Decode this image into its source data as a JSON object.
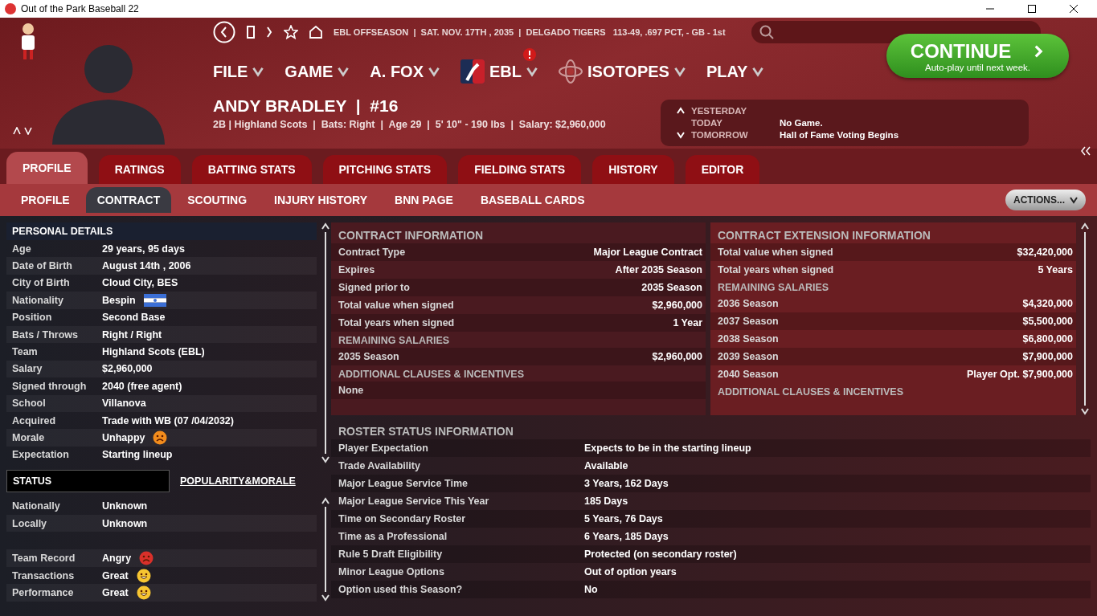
{
  "window": {
    "title": "Out of the Park Baseball 22"
  },
  "header": {
    "status": "EBL OFFSEASON  |  SAT. NOV. 17TH , 2035  |  DELGADO TIGERS   113-49, .697 PCT, - GB - 1st",
    "menus": [
      {
        "label": "FILE",
        "kind": "plain",
        "alert": false
      },
      {
        "label": "GAME",
        "kind": "plain",
        "alert": false
      },
      {
        "label": "A. FOX",
        "kind": "plain",
        "alert": false
      },
      {
        "label": "EBL",
        "kind": "league",
        "alert": true
      },
      {
        "label": "ISOTOPES",
        "kind": "team",
        "alert": false
      },
      {
        "label": "PLAY",
        "kind": "plain",
        "alert": false
      }
    ],
    "continue": {
      "label": "CONTINUE",
      "sub": "Auto-play until next week."
    },
    "player": {
      "name": "ANDY BRADLEY  |  #16",
      "info": "2B | Highland Scots  |  Bats: Right  |  Age 29  |  5' 10\" - 190 lbs  |  Salary: $2,960,000"
    },
    "calendar": [
      {
        "day": "YESTERDAY"
      },
      {
        "day": "TODAY",
        "event": "No Game."
      },
      {
        "day": "TOMORROW",
        "event": "Hall of Fame Voting Begins"
      }
    ]
  },
  "tabs": [
    {
      "label": "PROFILE",
      "selected": true
    },
    {
      "label": "RATINGS",
      "selected": false
    },
    {
      "label": "BATTING STATS",
      "selected": false
    },
    {
      "label": "PITCHING STATS",
      "selected": false
    },
    {
      "label": "FIELDING STATS",
      "selected": false
    },
    {
      "label": "HISTORY",
      "selected": false
    },
    {
      "label": "EDITOR",
      "selected": false
    }
  ],
  "subtabs": [
    {
      "label": "PROFILE",
      "selected": false
    },
    {
      "label": "CONTRACT",
      "selected": true
    },
    {
      "label": "SCOUTING",
      "selected": false
    },
    {
      "label": "INJURY HISTORY",
      "selected": false
    },
    {
      "label": "BNN PAGE",
      "selected": false
    },
    {
      "label": "BASEBALL CARDS",
      "selected": false
    }
  ],
  "actions": "ACTIONS...",
  "personal": {
    "title": "PERSONAL DETAILS",
    "rows": [
      {
        "label": "Age",
        "value": "29 years, 95 days",
        "kind": "plain"
      },
      {
        "label": "Date of Birth",
        "value": "August 14th , 2006",
        "kind": "plain"
      },
      {
        "label": "City of Birth",
        "value": "Cloud City, BES",
        "kind": "plain"
      },
      {
        "label": "Nationality",
        "value": "Bespin",
        "kind": "flag"
      },
      {
        "label": "Position",
        "value": "Second Base",
        "kind": "plain"
      },
      {
        "label": "Bats / Throws",
        "value": "Right / Right",
        "kind": "plain"
      },
      {
        "label": "Team",
        "value": "Highland Scots (EBL)",
        "kind": "plain"
      },
      {
        "label": "Salary",
        "value": "$2,960,000",
        "kind": "plain"
      },
      {
        "label": "Signed through",
        "value": "2040 (free agent)",
        "kind": "plain"
      },
      {
        "label": "School",
        "value": "Villanova",
        "kind": "plain"
      },
      {
        "label": "Acquired",
        "value": "Trade with WB (07 /04/2032)",
        "kind": "plain"
      },
      {
        "label": "Morale",
        "value": "Unhappy",
        "kind": "sad"
      },
      {
        "label": "Expectation",
        "value": "Starting lineup",
        "kind": "plain"
      }
    ]
  },
  "status": {
    "tabs": [
      {
        "label": "STATUS",
        "selected": true
      },
      {
        "label": "POPULARITY&MORALE",
        "selected": false
      }
    ],
    "rows": [
      {
        "label": "Nationally",
        "value": "Unknown",
        "kind": "plain"
      },
      {
        "label": "Locally",
        "value": "Unknown",
        "kind": "plain"
      },
      {
        "kind": "blank"
      },
      {
        "label": "Team Record",
        "value": "Angry",
        "kind": "angry"
      },
      {
        "label": "Transactions",
        "value": "Great",
        "kind": "happy"
      },
      {
        "label": "Performance",
        "value": "Great",
        "kind": "happy"
      }
    ]
  },
  "contract": {
    "title": "CONTRACT INFORMATION",
    "rows": [
      {
        "kind": "row",
        "label": "Contract Type",
        "value": "Major League Contract"
      },
      {
        "kind": "row",
        "label": "Expires",
        "value": "After 2035 Season"
      },
      {
        "kind": "row",
        "label": "Signed prior to",
        "value": "2035 Season"
      },
      {
        "kind": "row",
        "label": "Total value when signed",
        "value": "$2,960,000"
      },
      {
        "kind": "row",
        "label": "Total years when signed",
        "value": "1 Year"
      },
      {
        "kind": "heading",
        "label": "REMAINING SALARIES"
      },
      {
        "kind": "row",
        "label": "2035 Season",
        "value": "$2,960,000"
      },
      {
        "kind": "heading",
        "label": "ADDITIONAL CLAUSES & INCENTIVES"
      },
      {
        "kind": "row",
        "label": "None"
      }
    ]
  },
  "extension": {
    "title": "CONTRACT EXTENSION INFORMATION",
    "rows": [
      {
        "kind": "row",
        "label": "Total value when signed",
        "value": "$32,420,000"
      },
      {
        "kind": "row",
        "label": "Total years when signed",
        "value": "5 Years"
      },
      {
        "kind": "heading",
        "label": "REMAINING SALARIES"
      },
      {
        "kind": "row",
        "label": "2036 Season",
        "value": "$4,320,000"
      },
      {
        "kind": "row",
        "label": "2037 Season",
        "value": "$5,500,000"
      },
      {
        "kind": "row",
        "label": "2038 Season",
        "value": "$6,800,000"
      },
      {
        "kind": "row",
        "label": "2039 Season",
        "value": "$7,900,000"
      },
      {
        "kind": "row",
        "label": "2040 Season",
        "value": "Player Opt. $7,900,000"
      },
      {
        "kind": "heading",
        "label": "ADDITIONAL CLAUSES & INCENTIVES"
      }
    ]
  },
  "roster": {
    "title": "ROSTER STATUS INFORMATION",
    "rows": [
      {
        "label": "Player Expectation",
        "value": "Expects to be in the starting lineup"
      },
      {
        "label": "Trade Availability",
        "value": "Available"
      },
      {
        "label": "Major League Service Time",
        "value": "3 Years, 162 Days"
      },
      {
        "label": "Major League Service This Year",
        "value": "185 Days"
      },
      {
        "label": "Time on Secondary Roster",
        "value": "5 Years, 76 Days"
      },
      {
        "label": "Time as a Professional",
        "value": "6 Years, 185 Days"
      },
      {
        "label": "Rule 5 Draft Eligibility",
        "value": "Protected (on secondary roster)"
      },
      {
        "label": "Minor League Options",
        "value": "Out of option years"
      },
      {
        "label": "Option used this Season?",
        "value": "No"
      }
    ]
  }
}
